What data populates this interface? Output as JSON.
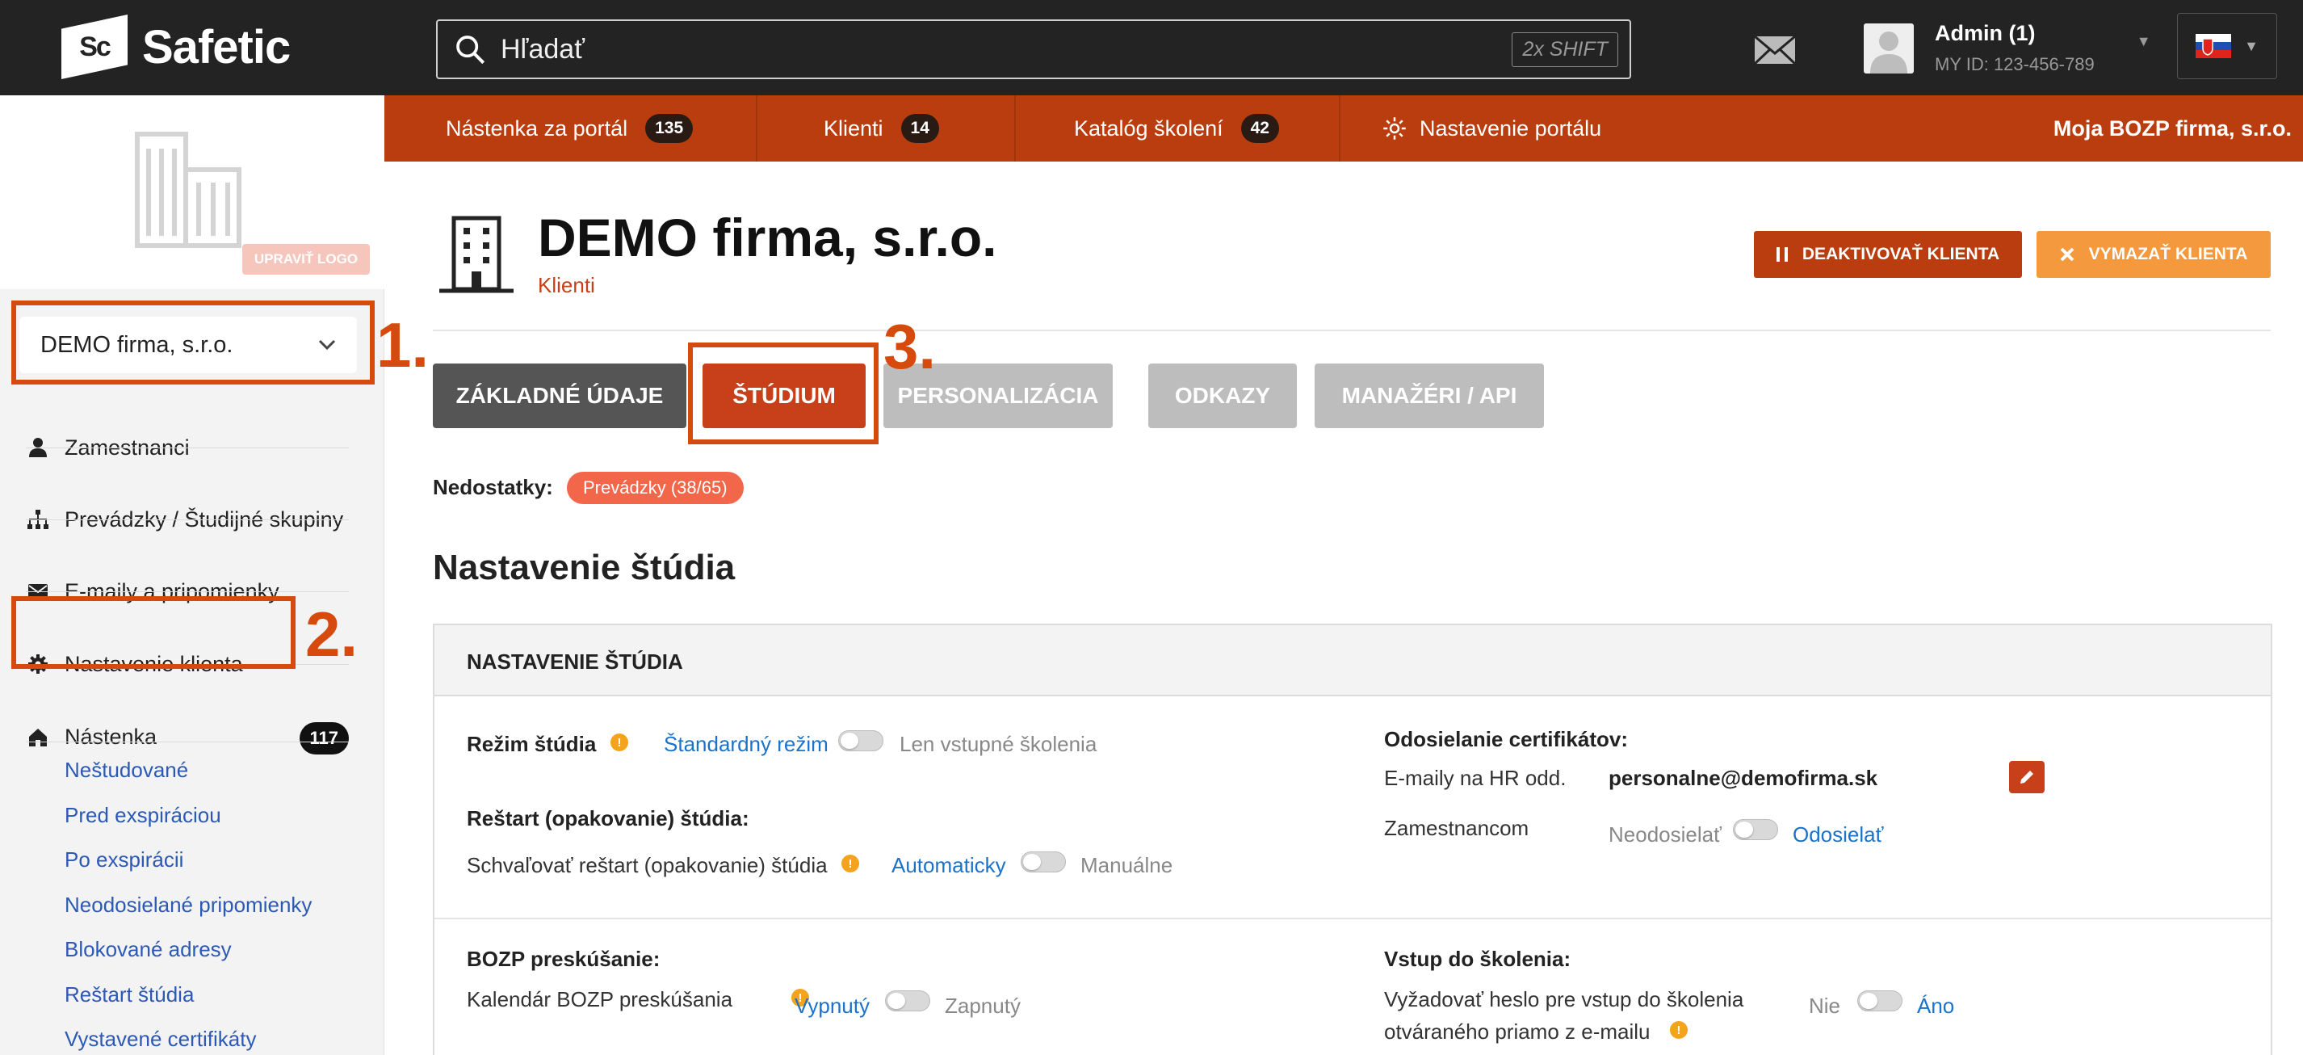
{
  "app": {
    "logo_badge": "Sc",
    "logo_text": "Safetic"
  },
  "search": {
    "placeholder": "Hľadať",
    "shortcut": "2x SHIFT"
  },
  "user": {
    "name": "Admin (1)",
    "id": "MY ID: 123-456-789"
  },
  "sidebar": {
    "upload_logo": "UPRAVIŤ LOGO",
    "client_select": "DEMO firma, s.r.o.",
    "items": [
      {
        "label": "Zamestnanci",
        "icon": "person-icon"
      },
      {
        "label": "Prevádzky / Študijné skupiny",
        "icon": "org-chart-icon"
      },
      {
        "label": "E-maily a pripomienky",
        "icon": "envelope-icon"
      },
      {
        "label": "Nastavenie klienta",
        "icon": "gear-icon"
      },
      {
        "label": "Nástenka",
        "icon": "dashboard-icon",
        "badge": "117"
      }
    ],
    "sublinks": [
      "Neštudované",
      "Pred exspiráciou",
      "Po exspirácii",
      "Neodosielané pripomienky",
      "Blokované adresy",
      "Reštart štúdia",
      "Vystavené certifikáty"
    ]
  },
  "annotations": {
    "one": "1.",
    "two": "2.",
    "three": "3.",
    "color": "#d64b0d"
  },
  "nav": {
    "items": [
      {
        "label": "Nástenka za portál",
        "badge": "135"
      },
      {
        "label": "Klienti",
        "badge": "14"
      },
      {
        "label": "Katalóg školení",
        "badge": "42"
      },
      {
        "label": "Nastavenie portálu"
      }
    ],
    "right": "Moja BOZP firma, s.r.o.",
    "color": "#b93d0f"
  },
  "page": {
    "title": "DEMO firma, s.r.o.",
    "breadcrumb": "Klienti",
    "deactivate_btn": "DEAKTIVOVAŤ KLIENTA",
    "delete_btn": "VYMAZAŤ KLIENTA",
    "tabs": [
      {
        "label": "ZÁKLADNÉ ÚDAJE",
        "state": "default"
      },
      {
        "label": "ŠTÚDIUM",
        "state": "active"
      },
      {
        "label": "PERSONALIZÁCIA",
        "state": "disabled"
      },
      {
        "label": "ODKAZY",
        "state": "disabled"
      },
      {
        "label": "MANAŽÉRI / API",
        "state": "disabled"
      }
    ],
    "deficiencies_label": "Nedostatky:",
    "deficiencies_pill": "Prevádzky (38/65)",
    "section_title": "Nastavenie štúdia"
  },
  "panel": {
    "header": "NASTAVENIE ŠTÚDIA",
    "study_mode": {
      "label": "Režim štúdia",
      "on": "Štandardný režim",
      "off": "Len vstupné školenia"
    },
    "restart": {
      "heading": "Reštart (opakovanie) štúdia:",
      "label": "Schvaľovať reštart (opakovanie) štúdia",
      "on": "Automaticky",
      "off": "Manuálne"
    },
    "certificates": {
      "heading": "Odosielanie certifikátov:",
      "hr_label": "E-maily na HR odd.",
      "hr_value": "personalne@demofirma.sk",
      "emp_label": "Zamestnancom",
      "emp_off": "Neodosielať",
      "emp_on": "Odosielať"
    },
    "bozp": {
      "heading": "BOZP preskúšanie:",
      "label": "Kalendár BOZP preskúšania",
      "on": "Vypnutý",
      "off": "Zapnutý"
    },
    "entry": {
      "heading": "Vstup do školenia:",
      "label1": "Vyžadovať heslo pre vstup do školenia",
      "label2": "otváraného priamo z e-mailu",
      "off": "Nie",
      "on": "Áno"
    }
  }
}
